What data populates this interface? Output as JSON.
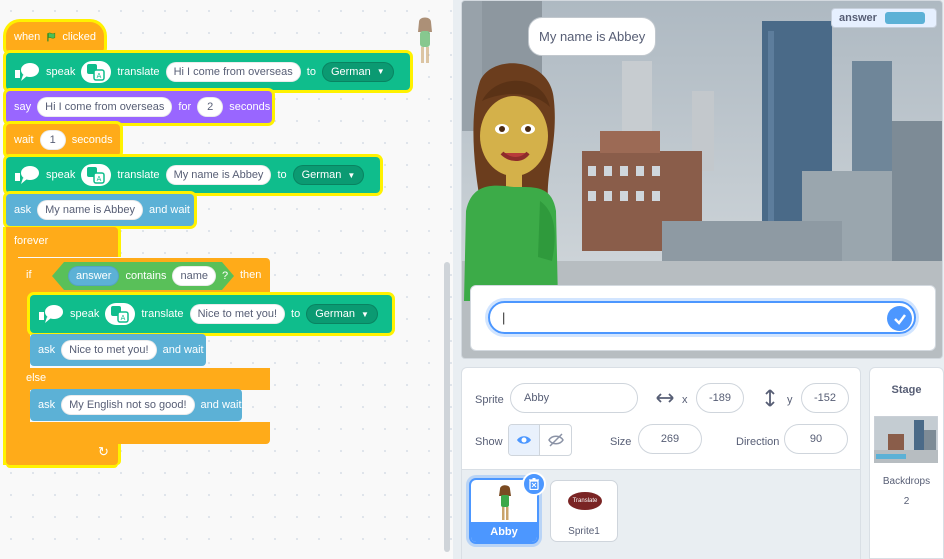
{
  "code": {
    "hat": {
      "when": "when",
      "clicked": "clicked"
    },
    "b1": {
      "speak": "speak",
      "translate": "translate",
      "text": "Hi I come from overseas",
      "to": "to",
      "lang": "German"
    },
    "b2": {
      "say": "say",
      "text": "Hi I come from overseas",
      "for": "for",
      "secs": "2",
      "unit": "seconds"
    },
    "b3": {
      "wait": "wait",
      "secs": "1",
      "unit": "seconds"
    },
    "b4": {
      "speak": "speak",
      "translate": "translate",
      "text": "My name is Abbey",
      "to": "to",
      "lang": "German"
    },
    "b5": {
      "ask": "ask",
      "text": "My name is Abbey",
      "wait": "and wait"
    },
    "forever": "forever",
    "if": {
      "if": "if",
      "answer": "answer",
      "contains": "contains",
      "name": "name",
      "q": "?",
      "then": "then"
    },
    "b6": {
      "speak": "speak",
      "translate": "translate",
      "text": "Nice to met you!",
      "to": "to",
      "lang": "German"
    },
    "b7": {
      "ask": "ask",
      "text": "Nice to met you!",
      "wait": "and wait"
    },
    "else": "else",
    "b8": {
      "ask": "ask",
      "text": "My English not so good!",
      "wait": "and wait"
    }
  },
  "stage": {
    "monitor_label": "answer",
    "speech_bubble": "My name is Abbey",
    "ask_input_value": "|"
  },
  "sprite_info": {
    "sprite_label": "Sprite",
    "sprite_name": "Abby",
    "x_label": "x",
    "x": "-189",
    "y_label": "y",
    "y": "-152",
    "show_label": "Show",
    "size_label": "Size",
    "size": "269",
    "direction_label": "Direction",
    "direction": "90",
    "sprites": [
      {
        "name": "Abby",
        "selected": true
      },
      {
        "name": "Sprite1",
        "selected": false,
        "thumb_text": "Translate"
      }
    ]
  },
  "stage_panel": {
    "title": "Stage",
    "backdrops_label": "Backdrops",
    "backdrops_count": "2"
  },
  "colors": {
    "events": "#ffab19",
    "looks": "#9966ff",
    "sensing": "#5cb1d6",
    "extension": "#0fbd8c",
    "operators": "#59c059",
    "highlight": "#fff200",
    "accent": "#4c97ff"
  }
}
